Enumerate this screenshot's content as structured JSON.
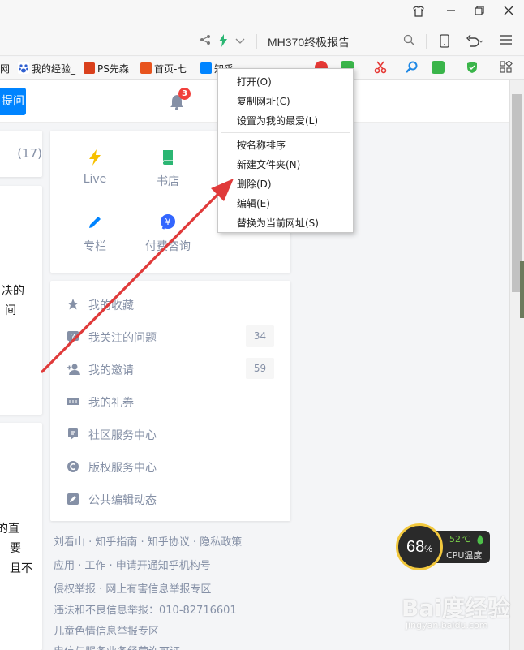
{
  "browser": {
    "search_text": "MH370终极报告",
    "bookmarks": [
      {
        "label": "网"
      },
      {
        "label": "我的经验_"
      },
      {
        "label": "PS先森"
      },
      {
        "label": "首页-七"
      },
      {
        "label": "知乎"
      }
    ]
  },
  "zhihu": {
    "ask_label": "提问",
    "notification_count": "3",
    "left_count": "(17)",
    "left_text_1": [
      "决的",
      "间"
    ],
    "left_text_2": [
      "的直",
      "要",
      "且不"
    ],
    "quick_access": [
      {
        "label": "Live",
        "icon": "lightning-icon",
        "color": "#f7c000"
      },
      {
        "label": "书店",
        "icon": "book-icon",
        "color": "#2bb673"
      },
      {
        "label": "专栏",
        "icon": "pen-icon",
        "color": "#0084ff"
      },
      {
        "label": "付费咨询",
        "icon": "yen-chat-icon",
        "color": "#3366ff"
      }
    ],
    "menu_list": [
      {
        "label": "我的收藏",
        "count": "",
        "icon": "star-icon"
      },
      {
        "label": "我关注的问题",
        "count": "34",
        "icon": "question-icon"
      },
      {
        "label": "我的邀请",
        "count": "59",
        "icon": "invite-icon"
      },
      {
        "label": "我的礼券",
        "count": "",
        "icon": "coupon-icon"
      },
      {
        "label": "社区服务中心",
        "count": "",
        "icon": "service-icon"
      },
      {
        "label": "版权服务中心",
        "count": "",
        "icon": "copyright-icon"
      },
      {
        "label": "公共编辑动态",
        "count": "",
        "icon": "edit-icon"
      }
    ],
    "footer": [
      "刘看山 · 知乎指南 · 知乎协议 · 隐私政策",
      "应用 · 工作 · 申请开通知乎机构号",
      "侵权举报 · 网上有害信息举报专区",
      "违法和不良信息举报：010-82716601",
      "儿童色情信息举报专区",
      "电信与服务业务经营许可证"
    ]
  },
  "context_menu": {
    "items": [
      "打开(O)",
      "复制网址(C)",
      "设置为我的最爱(L)",
      "按名称排序",
      "新建文件夹(N)",
      "删除(D)",
      "编辑(E)",
      "替换为当前网址(S)"
    ]
  },
  "cpu_widget": {
    "usage": "68",
    "usage_unit": "%",
    "temp": "52℃",
    "label": "CPU温度"
  },
  "watermark": {
    "brand": "Bai度经验",
    "url": "jingyan.baidu.com"
  },
  "colors": {
    "accent": "#0084ff",
    "annotation_arrow": "#e03a3a",
    "badge": "#f1403c"
  }
}
